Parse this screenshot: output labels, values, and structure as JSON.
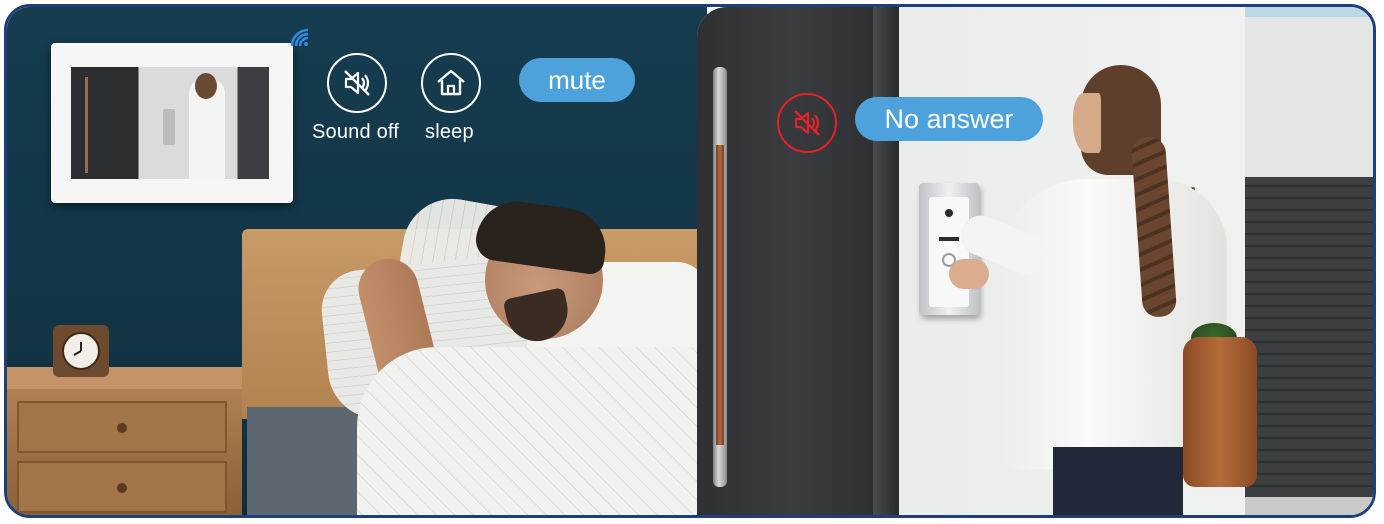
{
  "icons": {
    "sound_off": {
      "icon": "speaker-muted-icon",
      "label": "Sound off"
    },
    "sleep": {
      "icon": "home-icon",
      "label": "sleep"
    },
    "no_answer": {
      "icon": "speaker-muted-icon",
      "color": "#e3232a"
    },
    "wifi": {
      "icon": "wifi-icon",
      "color": "#2f8ae0"
    }
  },
  "badges": {
    "mute": "mute",
    "no_answer": "No answer"
  },
  "colors": {
    "pill_blue": "#4ea2dc",
    "frame_border": "#1f3f7a",
    "alert_red": "#e3232a"
  }
}
